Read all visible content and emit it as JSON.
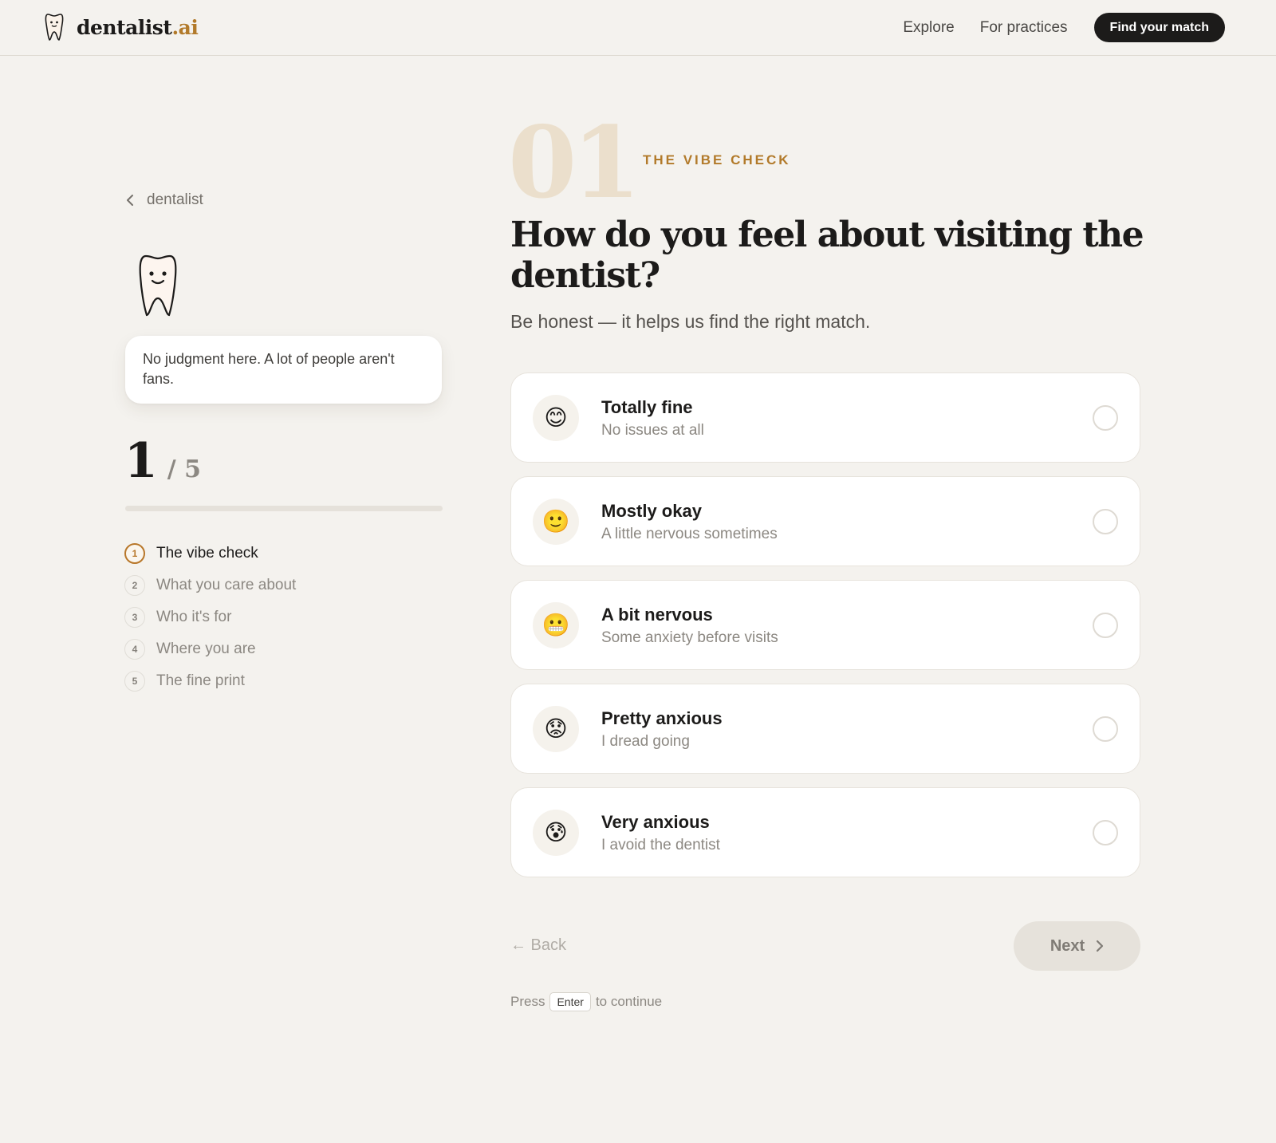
{
  "header": {
    "brand_main": "dentalist",
    "brand_accent": ".ai",
    "nav": [
      {
        "label": "Explore"
      },
      {
        "label": "For practices"
      }
    ],
    "cta_label": "Find your match"
  },
  "sidebar": {
    "back_label": "dentalist",
    "bubble_text": "No judgment here. A lot of people aren't fans.",
    "progress": {
      "current": "1",
      "total": "/ 5",
      "fraction": 0.0
    },
    "steps": [
      {
        "num": "1",
        "label": "The vibe check",
        "active": true
      },
      {
        "num": "2",
        "label": "What you care about",
        "active": false
      },
      {
        "num": "3",
        "label": "Who it's for",
        "active": false
      },
      {
        "num": "4",
        "label": "Where you are",
        "active": false
      },
      {
        "num": "5",
        "label": "The fine print",
        "active": false
      }
    ]
  },
  "main": {
    "step_number": "01",
    "eyebrow": "THE VIBE CHECK",
    "question": "How do you feel about visiting the dentist?",
    "subtitle": "Be honest — it helps us find the right match.",
    "options": [
      {
        "emoji": "😊",
        "title": "Totally fine",
        "sub": "No issues at all"
      },
      {
        "emoji": "🙂",
        "title": "Mostly okay",
        "sub": "A little nervous sometimes"
      },
      {
        "emoji": "😬",
        "title": "A bit nervous",
        "sub": "Some anxiety before visits"
      },
      {
        "emoji": "😟",
        "title": "Pretty anxious",
        "sub": "I dread going"
      },
      {
        "emoji": "😰",
        "title": "Very anxious",
        "sub": "I avoid the dentist"
      }
    ],
    "back_label": "← Back",
    "next_label": "Next",
    "hint_before": "Press",
    "hint_key": "Enter",
    "hint_after": "to continue"
  },
  "colors": {
    "background": "#f4f2ee",
    "accent": "#b27a2a",
    "ink": "#1c1b1a",
    "muted": "#8c8882"
  },
  "icons": {
    "logo": "tooth-icon",
    "back": "chevron-left-icon",
    "next": "chevron-right-icon",
    "mascot": "tooth-mascot-icon"
  }
}
